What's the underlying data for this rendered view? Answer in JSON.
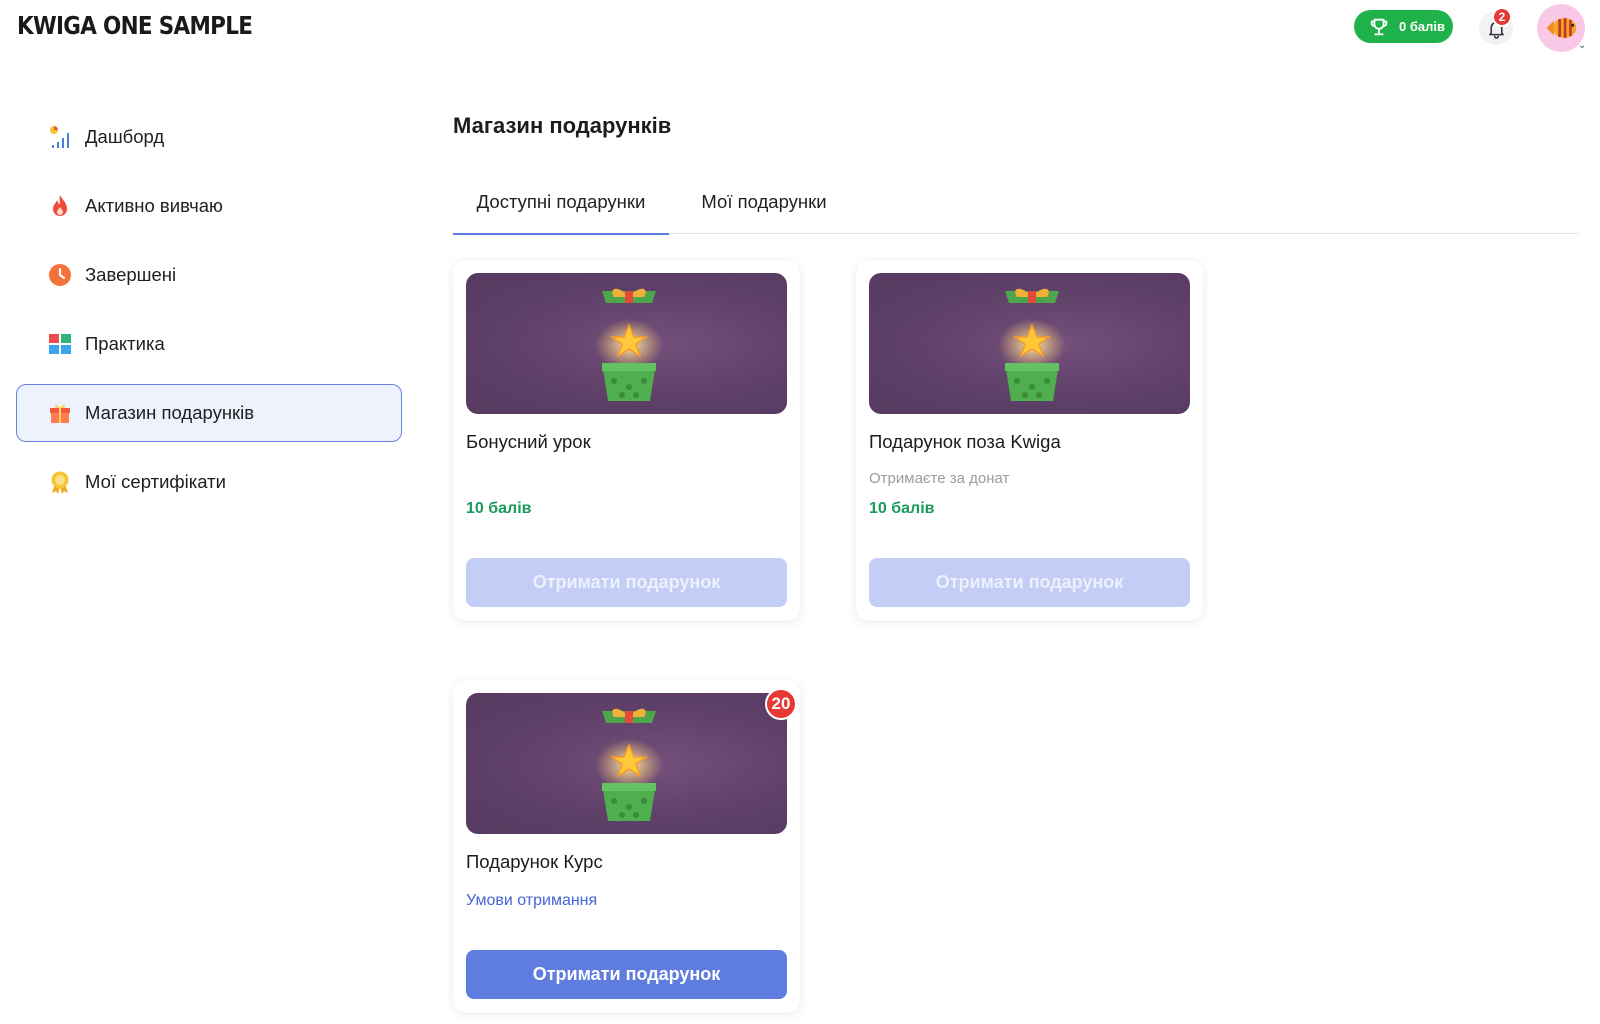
{
  "header": {
    "logo": "KWIGA ONE SAMPLE",
    "points_label": "0 балів",
    "notifications_count": "2",
    "trophy_icon": "trophy-icon",
    "bell_icon": "bell-icon",
    "avatar_icon": "fish-avatar-icon"
  },
  "sidebar": {
    "items": [
      {
        "label": "Дашборд",
        "icon": "chart-icon",
        "active": false
      },
      {
        "label": "Активно вивчаю",
        "icon": "fire-icon",
        "active": false
      },
      {
        "label": "Завершені",
        "icon": "clock-icon",
        "active": false
      },
      {
        "label": "Практика",
        "icon": "tiles-icon",
        "active": false
      },
      {
        "label": "Магазин подарунків",
        "icon": "gift-icon",
        "active": true
      },
      {
        "label": "Мої сертифікати",
        "icon": "award-icon",
        "active": false
      }
    ]
  },
  "main": {
    "title": "Магазин подарунків",
    "tabs": [
      {
        "label": "Доступні подарунки",
        "active": true
      },
      {
        "label": "Мої подарунки",
        "active": false
      }
    ],
    "cards": [
      {
        "title": "Бонусний урок",
        "subtitle": "",
        "price": "10 балів",
        "button": "Отримати подарунок",
        "enabled": false
      },
      {
        "title": "Подарунок поза Kwiga",
        "subtitle": "Отримаєте за донат",
        "price": "10 балів",
        "button": "Отримати подарунок",
        "enabled": false
      },
      {
        "title": "Подарунок Курс",
        "link": "Умови отримання",
        "button": "Отримати подарунок",
        "enabled": true,
        "badge": "20"
      }
    ]
  },
  "colors": {
    "accent": "#5e7ddf",
    "points_green": "#1fb24a",
    "price_green": "#1c9a5a",
    "badge_red": "#e53935",
    "card_image_bg": "#5e4068"
  }
}
